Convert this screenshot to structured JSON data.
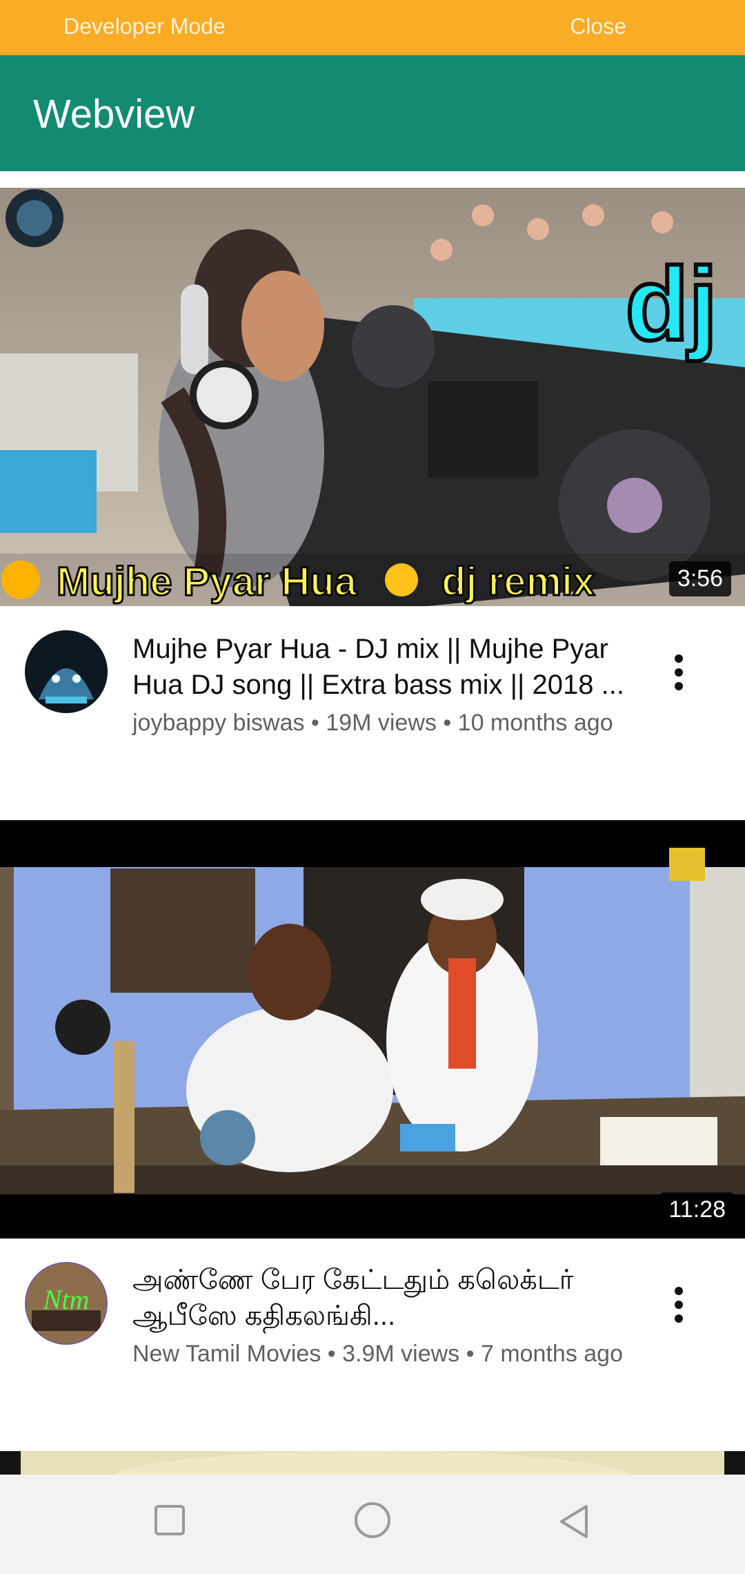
{
  "devbar": {
    "left_label": "Developer Mode",
    "right_label": "Close"
  },
  "appbar": {
    "title": "Webview"
  },
  "videos": [
    {
      "title": "Mujhe Pyar Hua - DJ mix || Mujhe Pyar Hua DJ song || Extra bass mix || 2018 ...",
      "meta": "joybappy biswas • 19M views • 10 months ago",
      "duration": "3:56",
      "thumb_text": {
        "dj": "dj",
        "caption_left": "Mujhe Pyar Hua",
        "caption_right": "dj remix"
      }
    },
    {
      "title": "அண்ணே பேர கேட்டதும் கலெக்டர் ஆபீஸே கதிகலங்கி...",
      "meta": "New Tamil Movies • 3.9M views • 7 months ago",
      "duration": "11:28",
      "avatar_text": "Ntm"
    }
  ],
  "navbar": {
    "icons": [
      "recents-square-icon",
      "home-circle-icon",
      "back-triangle-icon"
    ]
  }
}
